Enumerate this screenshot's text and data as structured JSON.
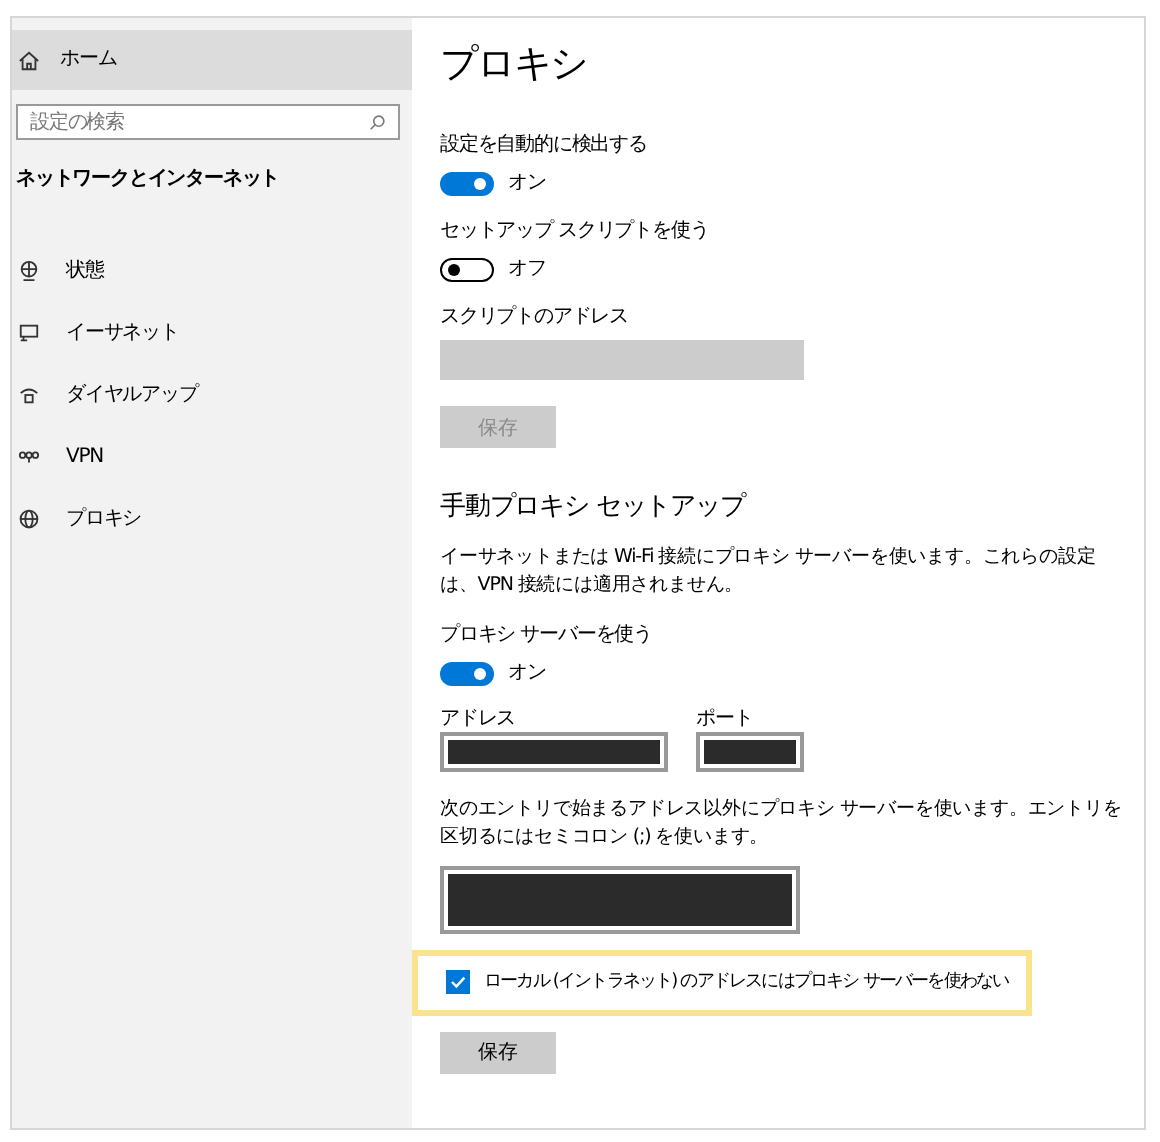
{
  "sidebar": {
    "home": {
      "label": "ホーム",
      "selected": true
    },
    "search": {
      "placeholder": "設定の検索"
    },
    "section_title": "ネットワークとインターネット",
    "items": [
      {
        "label": "状態",
        "kind": "status"
      },
      {
        "label": "イーサネット",
        "kind": "ethernet"
      },
      {
        "label": "ダイヤルアップ",
        "kind": "dialup"
      },
      {
        "label": "VPN",
        "kind": "vpn"
      },
      {
        "label": "プロキシ",
        "kind": "proxy"
      }
    ]
  },
  "page_title": "プロキシ",
  "auto_setup": {
    "detect": {
      "label": "設定を自動的に検出する",
      "on": true,
      "state_text": "オン"
    },
    "script": {
      "label": "セットアップ スクリプトを使う",
      "on": false,
      "state_text": "オフ"
    },
    "script_address": {
      "label": "スクリプトのアドレス",
      "disabled": true
    },
    "save": {
      "label": "保存",
      "disabled": true
    }
  },
  "manual_setup": {
    "heading": "手動プロキシ セットアップ",
    "description": "イーサネットまたは Wi-Fi 接続にプロキシ サーバーを使います。これらの設定は、VPN 接続には適用されません。",
    "use_proxy": {
      "label": "プロキシ サーバーを使う",
      "on": true,
      "state_text": "オン"
    },
    "address": {
      "label": "アドレス"
    },
    "port": {
      "label": "ポート"
    },
    "exceptions_note": "次のエントリで始まるアドレス以外にプロキシ サーバーを使います。エントリを区切るにはセミコロン (;) を使います。",
    "bypass_local": {
      "label": "ローカル (イントラネット) のアドレスにはプロキシ サーバーを使わない",
      "checked": true,
      "highlighted": true
    },
    "save": {
      "label": "保存",
      "disabled": false
    }
  }
}
